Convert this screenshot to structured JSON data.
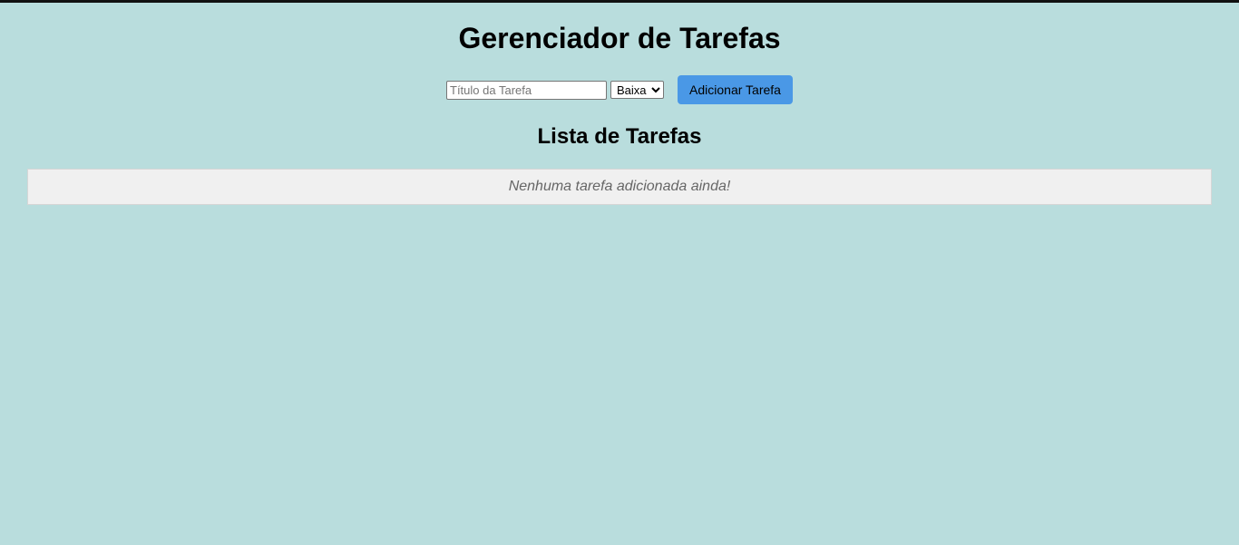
{
  "header": {
    "title": "Gerenciador de Tarefas"
  },
  "form": {
    "task_input": {
      "value": "",
      "placeholder": "Título da Tarefa"
    },
    "priority_select": {
      "selected": "Baixa"
    },
    "add_button_label": "Adicionar Tarefa"
  },
  "task_list": {
    "title": "Lista de Tarefas",
    "items": [],
    "empty_message": "Nenhuma tarefa adicionada ainda!"
  },
  "colors": {
    "background": "#b9dddd",
    "button": "#4a98e6",
    "empty_box": "#f0f0f0"
  }
}
